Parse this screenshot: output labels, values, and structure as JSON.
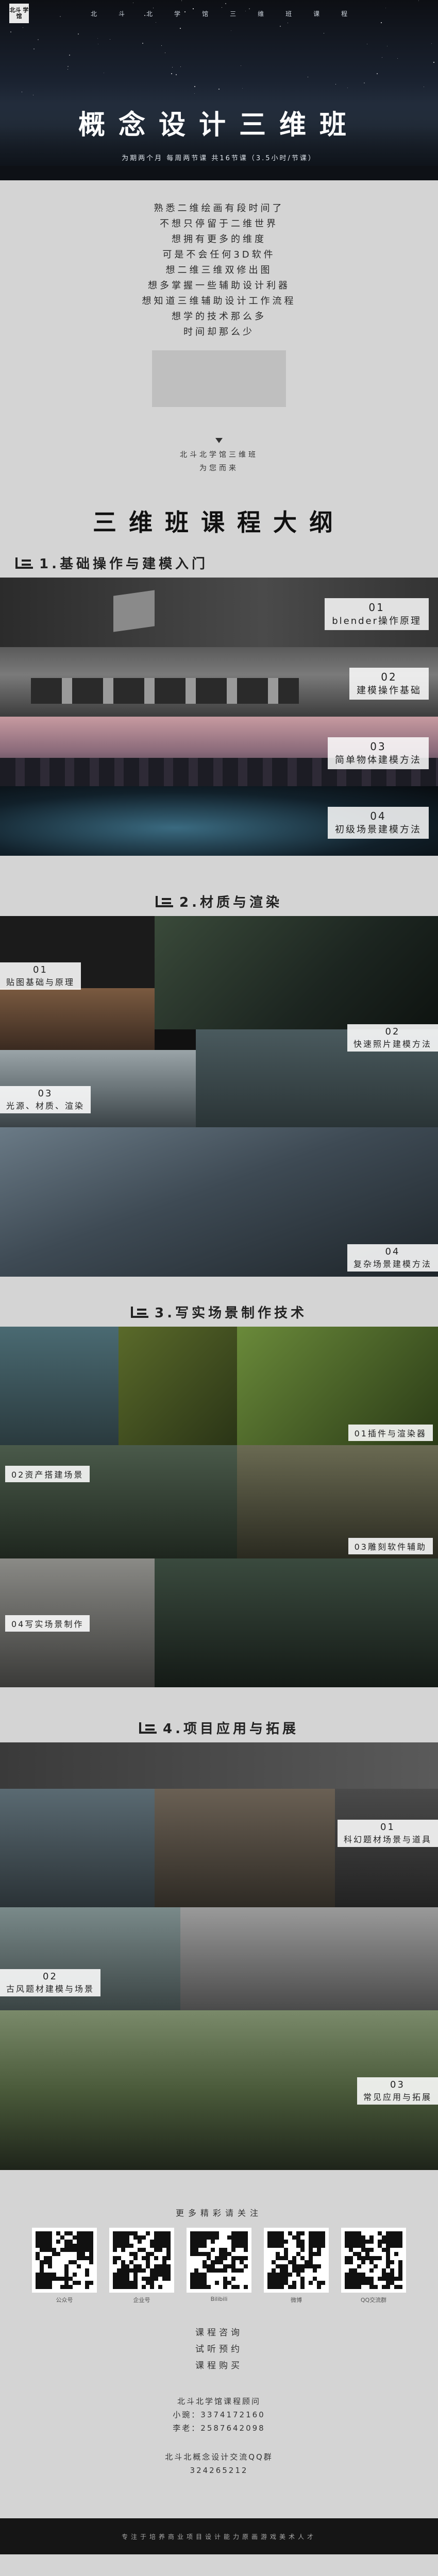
{
  "hero": {
    "logo": "北斗\n学馆",
    "nav": [
      "北",
      "斗",
      "北",
      "学",
      "馆",
      "三",
      "维",
      "班",
      "课",
      "程"
    ],
    "title": "概念设计三维班",
    "subtitle": "为期两个月  每周两节课  共16节课（3.5小时/节课）"
  },
  "intro": {
    "lines": [
      "熟悉二维绘画有段时间了",
      "不想只停留于二维世界",
      "想拥有更多的维度",
      "可是不会任何3D软件",
      "想二维三维双修出图",
      "想多掌握一些辅助设计利器",
      "想知道三维辅助设计工作流程",
      "想学的技术那么多",
      "时间却那么少"
    ]
  },
  "mini": {
    "lines": [
      "北斗北学馆三维班",
      "为您而来"
    ]
  },
  "main_title": "三维班课程大纲",
  "sections": [
    {
      "heading": "1.基础操作与建模入门",
      "strips": [
        {
          "num": "01",
          "label": "blender操作原理"
        },
        {
          "num": "02",
          "label": "建模操作基础"
        },
        {
          "num": "03",
          "label": "简单物体建模方法"
        },
        {
          "num": "04",
          "label": "初级场景建模方法"
        }
      ]
    },
    {
      "heading": "2.材质与渲染",
      "tags": [
        {
          "num": "01",
          "label": "贴图基础与原理"
        },
        {
          "num": "02",
          "label": "快速照片建模方法"
        },
        {
          "num": "03",
          "label": "光源、材质、渲染"
        },
        {
          "num": "04",
          "label": "复杂场景建模方法"
        }
      ]
    },
    {
      "heading": "3.写实场景制作技术",
      "tags": [
        {
          "label": "01插件与渲染器"
        },
        {
          "label": "02资产搭建场景"
        },
        {
          "label": "03雕刻软件辅助"
        },
        {
          "label": "04写实场景制作"
        }
      ]
    },
    {
      "heading": "4.项目应用与拓展",
      "tags": [
        {
          "num": "01",
          "label": "科幻题材场景与道具"
        },
        {
          "num": "02",
          "label": "古风题材建模与场景"
        },
        {
          "num": "03",
          "label": "常见应用与拓展"
        }
      ]
    }
  ],
  "qr": {
    "title": "更多精彩请关注",
    "items": [
      {
        "caption": "公众号"
      },
      {
        "caption": "企业号"
      },
      {
        "caption": "Bilibili"
      },
      {
        "caption": "微博"
      },
      {
        "caption": "QQ交流群"
      }
    ]
  },
  "contact": {
    "lines": [
      "课程咨询",
      "试听预约",
      "课程购买"
    ],
    "org": "北斗北学馆课程顾问",
    "phone1": "小豌：3374172160",
    "phone2": "李老：2587642098",
    "group_title": "北斗北概念设计交流QQ群",
    "group_num": "324265212"
  },
  "footer": "专注于培养商业项目设计能力原画游戏美术人才"
}
